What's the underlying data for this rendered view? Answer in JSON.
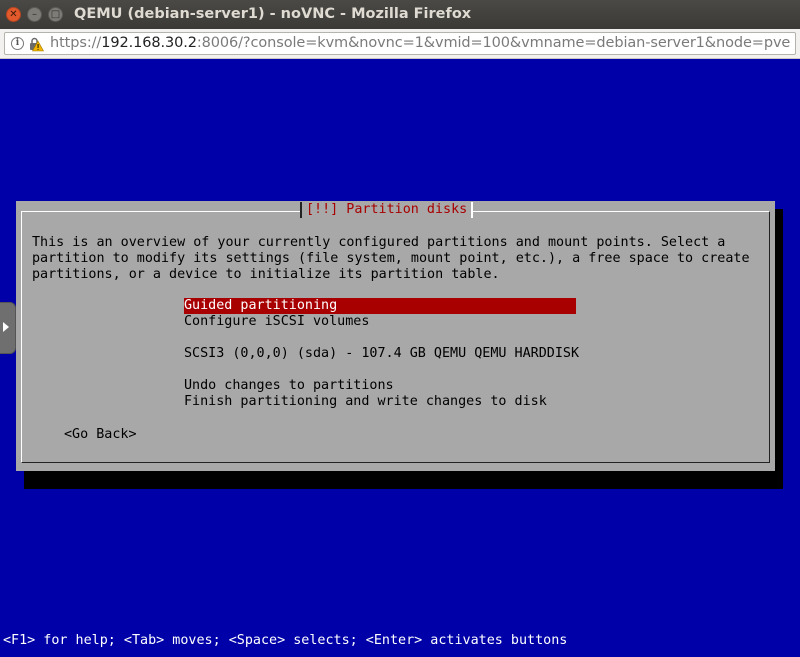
{
  "window": {
    "title": "QEMU (debian-server1) - noVNC - Mozilla Firefox",
    "close_glyph": "✕",
    "min_glyph": "–",
    "max_glyph": "□"
  },
  "urlbar": {
    "scheme": "https://",
    "host": "192.168.30.2",
    "rest": ":8006/?console=kvm&novnc=1&vmid=100&vmname=debian-server1&node=pve",
    "info_glyph": "i",
    "icons": [
      "info-icon",
      "lock-warning-icon"
    ]
  },
  "installer": {
    "dialog_title": "[!!] Partition disks",
    "description": [
      "This is an overview of your currently configured partitions and mount points. Select a",
      "partition to modify its settings (file system, mount point, etc.), a free space to create",
      "partitions, or a device to initialize its partition table."
    ],
    "menu": [
      {
        "label": "Guided partitioning",
        "selected": true
      },
      {
        "label": "Configure iSCSI volumes",
        "selected": false
      },
      {
        "label": "SCSI3 (0,0,0) (sda) - 107.4 GB QEMU QEMU HARDDISK",
        "selected": false
      },
      {
        "label": "Undo changes to partitions",
        "selected": false
      },
      {
        "label": "Finish partitioning and write changes to disk",
        "selected": false
      }
    ],
    "go_back": "<Go Back>",
    "help_line": "<F1> for help; <Tab> moves; <Space> selects; <Enter> activates buttons"
  },
  "colors": {
    "screen_bg": "#0000a8",
    "dialog_bg": "#a8a8a8",
    "highlight": "#a80000"
  }
}
